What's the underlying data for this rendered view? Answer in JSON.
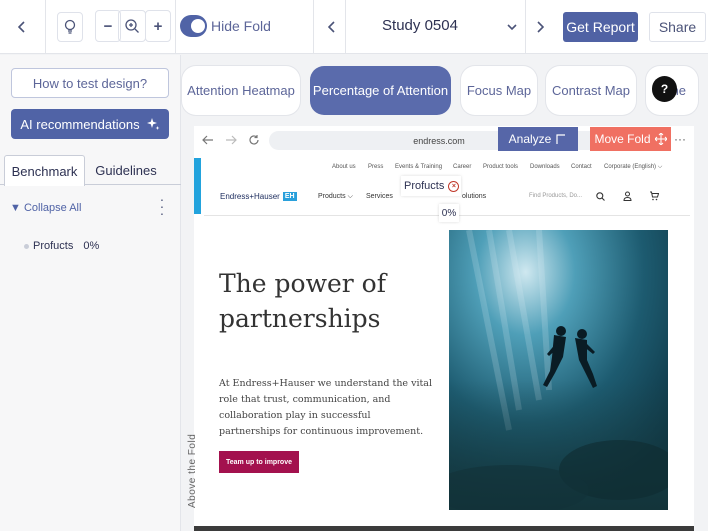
{
  "toolbar": {
    "hide_fold_label": "Hide Fold",
    "study_title": "Study 0504",
    "get_report_label": "Get Report",
    "share_label": "Share",
    "zoom_out": "−",
    "zoom_in": "+"
  },
  "sidebar": {
    "how_to_test_label": "How to test design?",
    "ai_label": "AI recommendations",
    "tabs": [
      {
        "label": "Benchmark",
        "active": true
      },
      {
        "label": "Guidelines",
        "active": false
      }
    ],
    "collapse_label": "▼ Collapse All",
    "aois": [
      {
        "name": "Profucts",
        "value": "0%"
      }
    ]
  },
  "analysis_tabs": [
    {
      "label": "Attention Heatmap",
      "active": false
    },
    {
      "label": "Percentage of Attention",
      "active": true
    },
    {
      "label": "Focus Map",
      "active": false
    },
    {
      "label": "Contrast Map",
      "active": false
    },
    {
      "label": "he",
      "active": false
    }
  ],
  "help_label": "?",
  "browser": {
    "url": "endress.com",
    "analyze_label": "Analyze",
    "move_fold_label": "Move Fold",
    "more_label": "···"
  },
  "site": {
    "util_nav": [
      "About us",
      "Press",
      "Events & Training",
      "Career",
      "Product tools",
      "Downloads",
      "Contact",
      "Corporate (English) ⌵"
    ],
    "logo_text": "Endress+Hauser",
    "logo_badge": "EH",
    "main_nav": [
      "Products ⌵",
      "Services",
      "olutions"
    ],
    "search_placeholder": "Find Products, Do...",
    "hero_title": "The power of partnerships",
    "hero_text": "At Endress+Hauser we understand the vital role that trust, communication, and collaboration play in successful partnerships for continuous improvement.",
    "cta_label": "Team up to improve"
  },
  "aoi_overlay": {
    "name": "Profucts",
    "percent": "0%"
  },
  "fold_label": "Above the Fold"
}
